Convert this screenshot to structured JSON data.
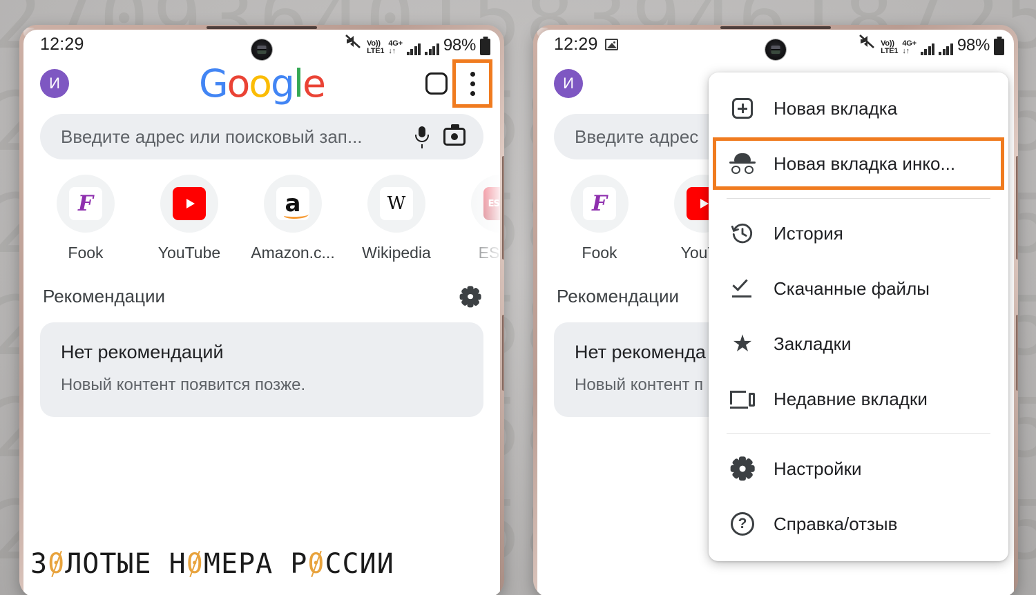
{
  "background": {
    "digit_pattern": "2709364015839461872530427093640158394618725304",
    "base_color": "#c6c4c3"
  },
  "watermark": {
    "prefix": "З",
    "w_text_parts": [
      "З",
      "0",
      "ЛОТЫЕ Н",
      "0",
      "МЕРА Р",
      "0",
      "ССИИ"
    ],
    "full_text": "ЗОЛОТЫЕ НОМЕРА РОССИИ",
    "accent_color": "#E8A33D"
  },
  "highlight_color": "#F07B1F",
  "phone_left": {
    "status": {
      "time": "12:29",
      "volte_top": "Vo))",
      "volte_bottom": "LTE1",
      "network": "4G+",
      "data_arrows": "↓↑",
      "battery_percent": "98%",
      "mute_icon": "speaker-muted-icon"
    },
    "toolbar": {
      "avatar_letter": "И",
      "avatar_color": "#7e57c2",
      "logo": [
        "G",
        "o",
        "o",
        "g",
        "l",
        "e"
      ],
      "tab_switcher_label": "Вкладки",
      "menu_label": "Меню"
    },
    "search": {
      "placeholder": "Введите адрес или поисковый зап...",
      "mic_label": "Голосовой поиск",
      "lens_label": "Поиск по картинке"
    },
    "shortcuts": [
      {
        "label": "Fook",
        "icon": "fook-icon",
        "glyph": "F"
      },
      {
        "label": "YouTube",
        "icon": "youtube-icon"
      },
      {
        "label": "Amazon.c...",
        "icon": "amazon-icon",
        "glyph": "a"
      },
      {
        "label": "Wikipedia",
        "icon": "wikipedia-icon",
        "glyph": "W"
      },
      {
        "label": "ESPN",
        "icon": "espn-icon",
        "glyph": "ESPN"
      }
    ],
    "recommendations": {
      "title": "Рекомендации",
      "settings_icon": "gear-icon",
      "empty_title": "Нет рекомендаций",
      "empty_subtitle": "Новый контент появится позже."
    }
  },
  "phone_right": {
    "status": {
      "time": "12:29",
      "screenshot_icon": "image-badge-icon",
      "volte_top": "Vo))",
      "volte_bottom": "LTE1",
      "network": "4G+",
      "data_arrows": "↓↑",
      "battery_percent": "98%"
    },
    "toolbar": {
      "avatar_letter": "И",
      "avatar_color": "#7e57c2"
    },
    "search": {
      "placeholder": "Введите адрес"
    },
    "shortcuts": [
      {
        "label": "Fook",
        "icon": "fook-icon",
        "glyph": "F"
      },
      {
        "label": "YouTu",
        "icon": "youtube-icon"
      }
    ],
    "recommendations": {
      "title": "Рекомендации",
      "empty_title": "Нет рекоменда",
      "empty_subtitle": "Новый контент п"
    },
    "overflow_menu": {
      "items": [
        {
          "label": "Новая вкладка",
          "icon": "plus-box-icon",
          "highlighted": false
        },
        {
          "label": "Новая вкладка инко...",
          "icon": "incognito-icon",
          "highlighted": true
        },
        {
          "label": "История",
          "icon": "history-icon",
          "highlighted": false
        },
        {
          "label": "Скачанные файлы",
          "icon": "download-check-icon",
          "highlighted": false
        },
        {
          "label": "Закладки",
          "icon": "star-icon",
          "highlighted": false
        },
        {
          "label": "Недавние вкладки",
          "icon": "recent-tabs-icon",
          "highlighted": false
        },
        {
          "label": "Настройки",
          "icon": "gear-icon",
          "highlighted": false
        },
        {
          "label": "Справка/отзыв",
          "icon": "help-circle-icon",
          "highlighted": false
        }
      ],
      "star_glyph": "★",
      "help_glyph": "?"
    }
  }
}
